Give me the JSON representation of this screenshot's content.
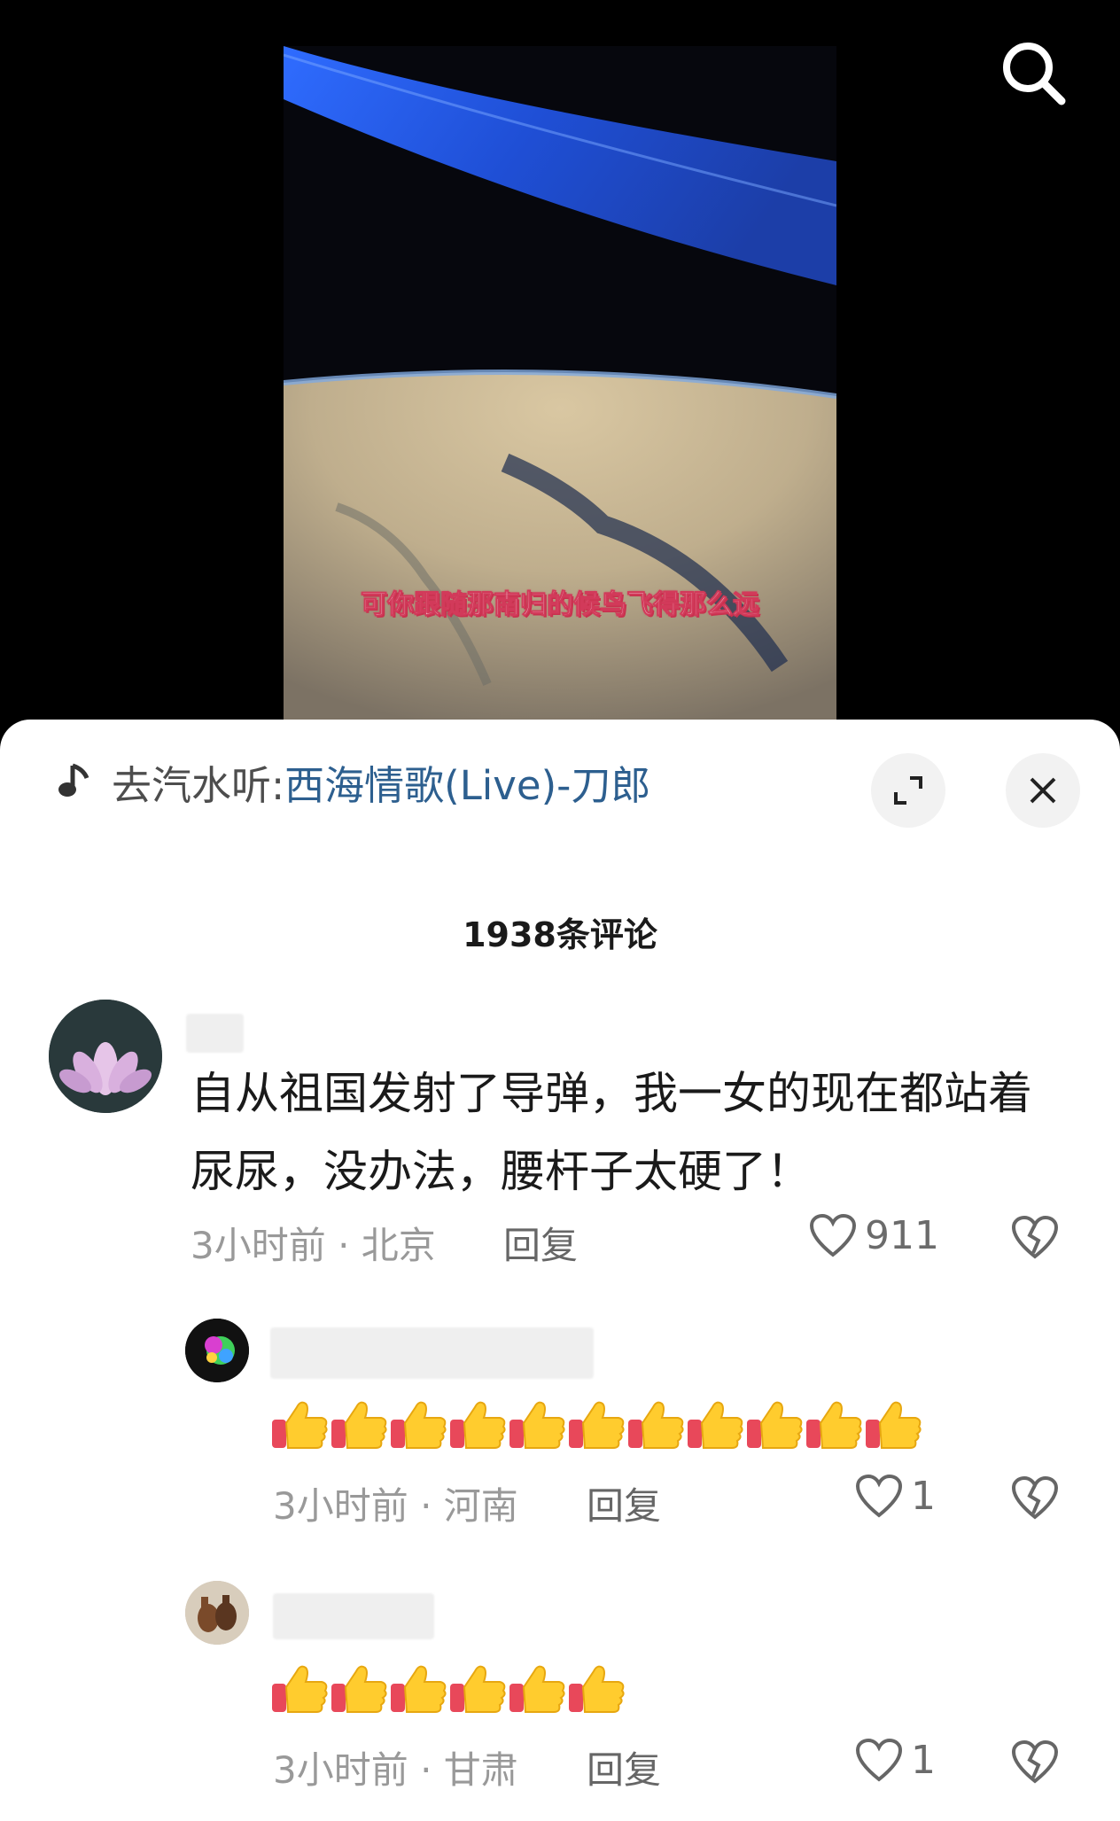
{
  "video": {
    "subtitle": "可你跟随那南归的候鸟飞得那么远"
  },
  "music": {
    "prefix": "去汽水听: ",
    "song": "西海情歌(Live)-刀郎"
  },
  "comments_header": "1938条评论",
  "comments": [
    {
      "text": "自从祖国发射了导弹，我一女的现在都站着尿尿，没办法，腰杆子太硬了！",
      "time_location": "3小时前 · 北京",
      "reply_label": "回复",
      "likes": "911"
    },
    {
      "emoji_count": 11,
      "time_location": "3小时前 · 河南",
      "reply_label": "回复",
      "likes": "1"
    },
    {
      "emoji_count": 6,
      "time_location": "3小时前 · 甘肃",
      "reply_label": "回复",
      "likes": "1"
    }
  ],
  "icons": [
    "search-icon",
    "music-note-icon",
    "expand-icon",
    "close-icon",
    "heart-icon",
    "broken-heart-icon",
    "thumbs-up-emoji"
  ]
}
